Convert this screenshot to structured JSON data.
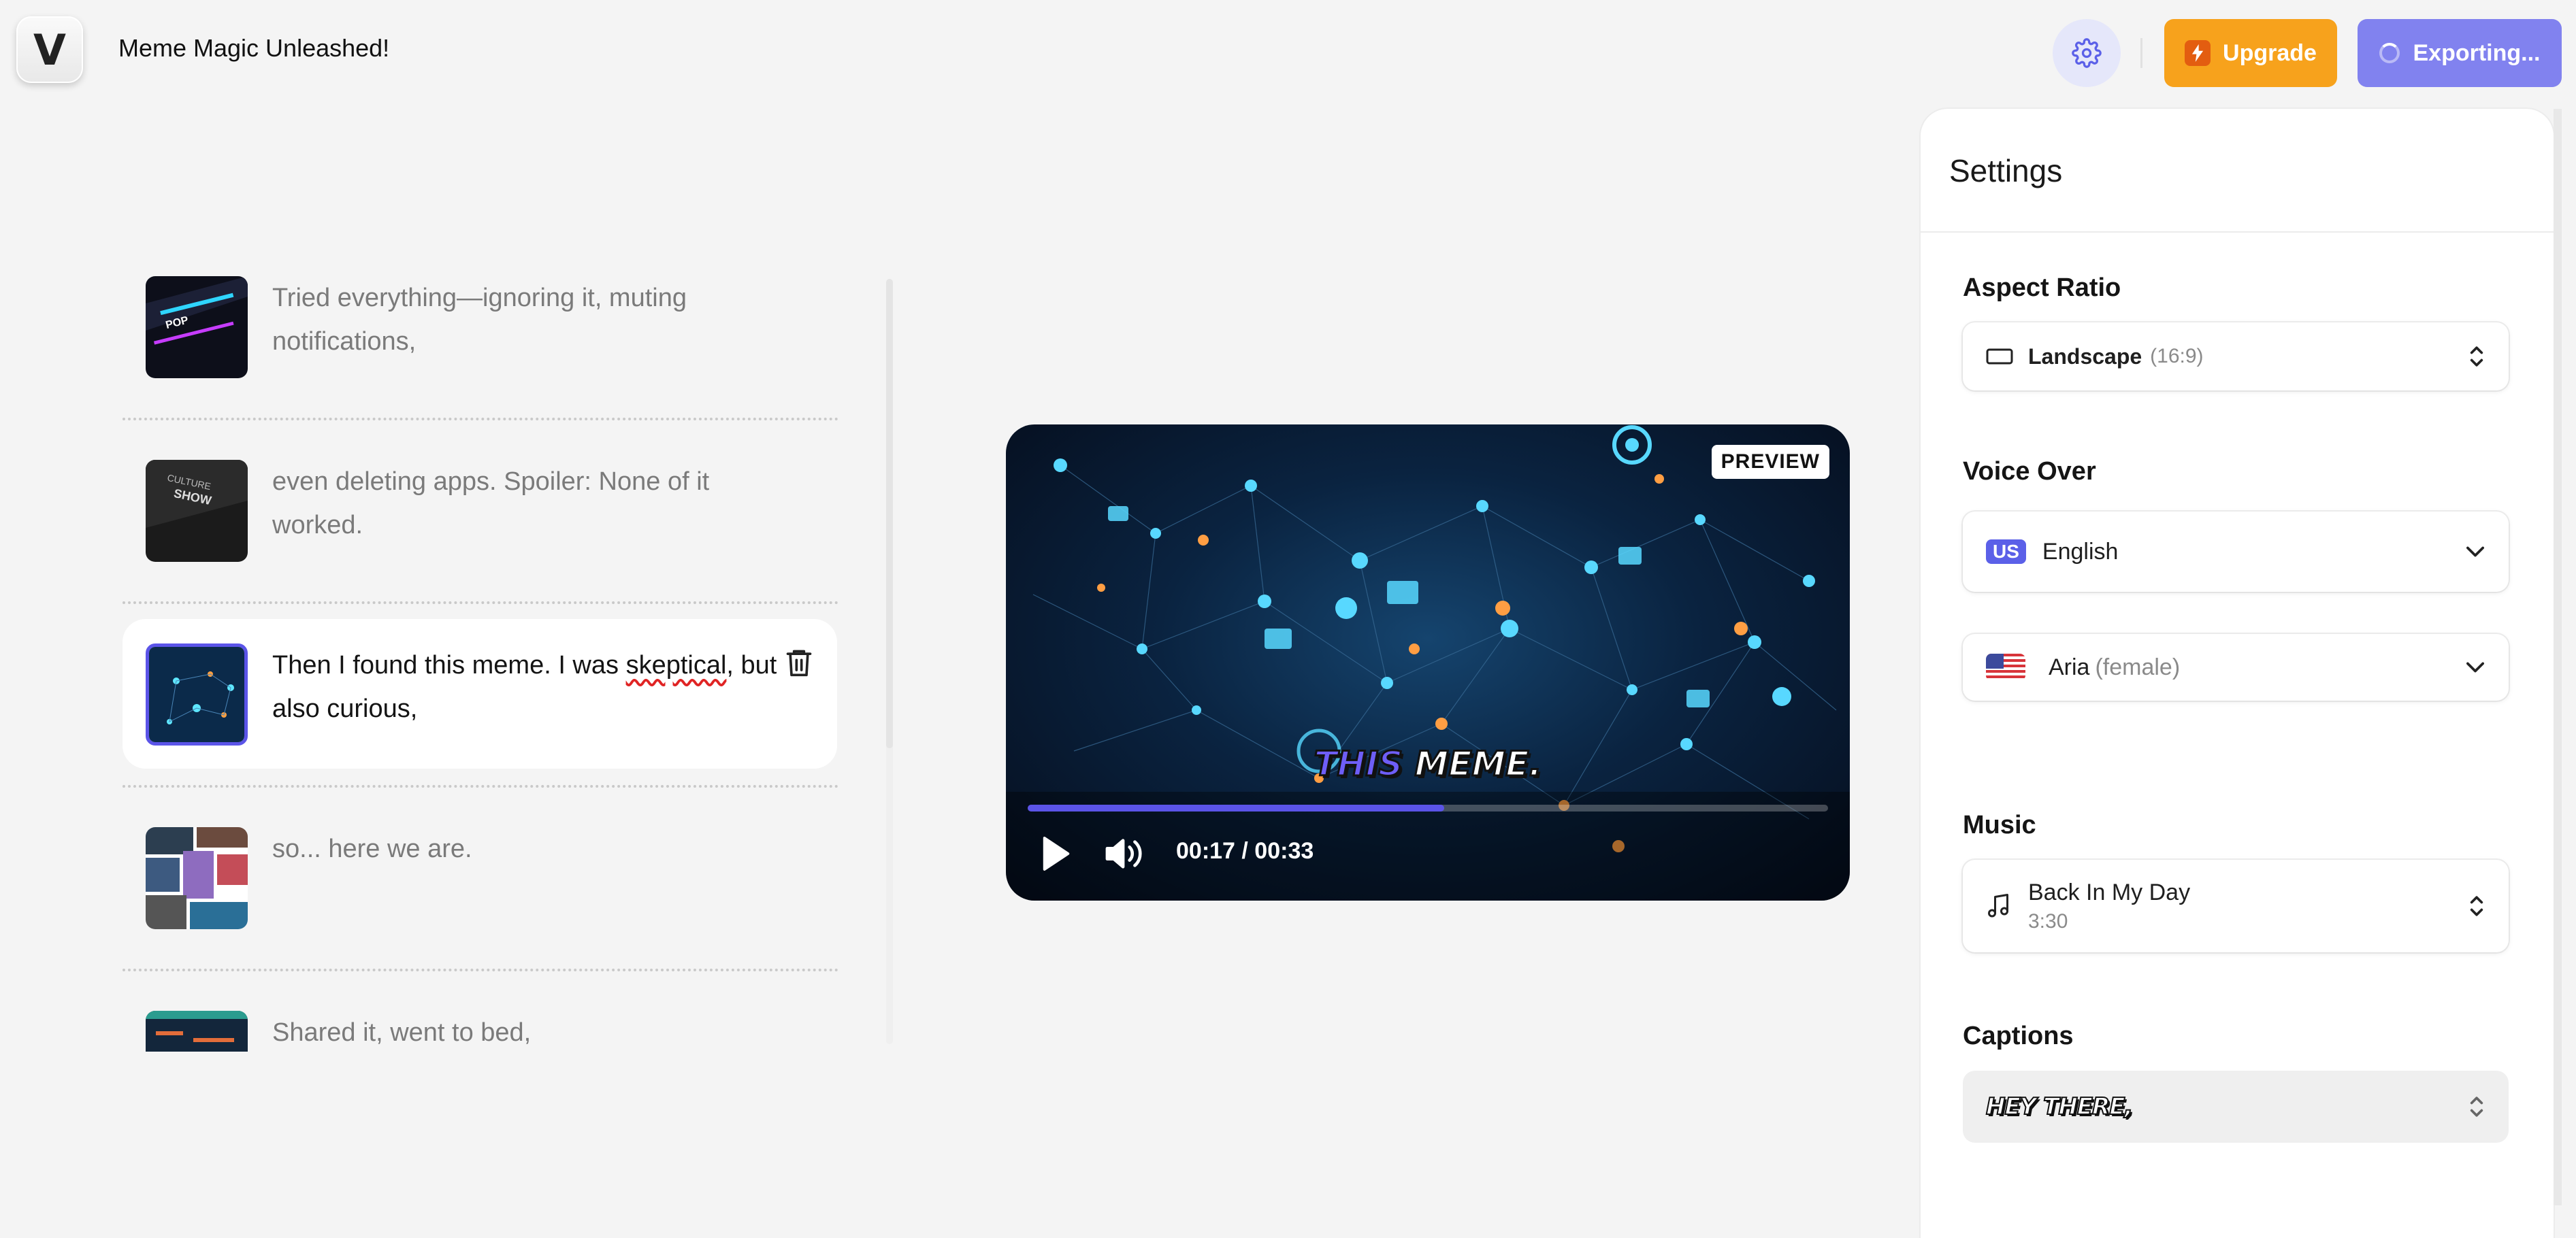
{
  "header": {
    "logo_letter": "V",
    "title": "Meme Magic Unleashed!",
    "upgrade_label": "Upgrade",
    "export_label": "Exporting..."
  },
  "scenes": [
    {
      "text": "Tried everything—ignoring it, muting notifications,",
      "active": false
    },
    {
      "text": "even deleting apps. Spoiler: None of it worked.",
      "active": false
    },
    {
      "text_before": "Then I found this meme. I was ",
      "text_highlight": "skeptical",
      "text_after": ", but also curious,",
      "active": true
    },
    {
      "text": "so... here we are.",
      "active": false
    },
    {
      "text": "Shared it, went to bed,",
      "active": false
    }
  ],
  "video": {
    "badge": "PREVIEW",
    "caption_word1": "THIS",
    "caption_word2": "MEME.",
    "time_display": "00:17 / 00:33",
    "progress": 0.52
  },
  "settings": {
    "title": "Settings",
    "aspect_ratio": {
      "label": "Aspect Ratio",
      "value": "Landscape",
      "hint": "(16:9)"
    },
    "voice_over": {
      "label": "Voice Over",
      "language_badge": "US",
      "language": "English",
      "voice": "Aria",
      "voice_hint": "(female)"
    },
    "music": {
      "label": "Music",
      "track": "Back In My Day",
      "duration": "3:30"
    },
    "captions": {
      "label": "Captions",
      "style_preview": "HEY THERE,"
    }
  },
  "colors": {
    "accent": "#5b54e8",
    "upgrade": "#f7a21c",
    "export": "#8182ef"
  }
}
